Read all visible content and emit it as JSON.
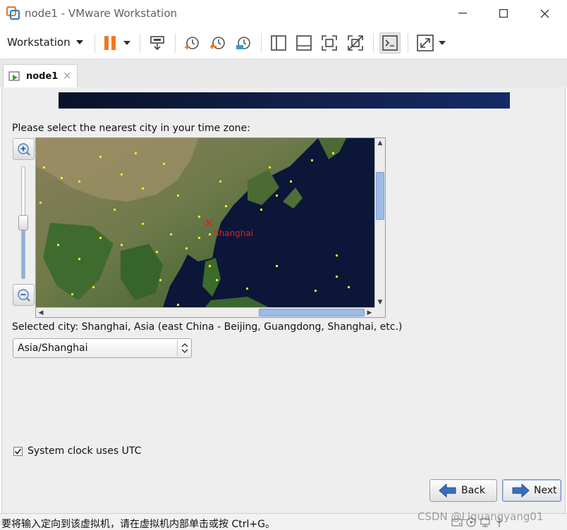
{
  "window": {
    "title": "node1 - VMware Workstation",
    "controls": [
      "minimize-icon",
      "maximize-icon",
      "close-icon"
    ]
  },
  "toolbar": {
    "workstation_menu": "Workstation",
    "icons": [
      "pause-icon",
      "send-ctrl-alt-del-icon",
      "snapshot-take-icon",
      "snapshot-revert-icon",
      "snapshot-manager-icon",
      "sidebar-toggle-icon",
      "thumbnail-bar-icon",
      "fullscreen-icon",
      "unity-icon",
      "console-view-icon",
      "stretch-guest-icon"
    ]
  },
  "tabs": [
    {
      "label": "node1",
      "icon": "vm-running-icon",
      "close": "×"
    }
  ],
  "installer": {
    "prompt": "Please select the nearest city in your time zone:",
    "map_city_label": "Shanghai",
    "selected_city_text": "Selected city: Shanghai, Asia (east China - Beijing, Guangdong, Shanghai, etc.)",
    "timezone_value": "Asia/Shanghai",
    "utc_checkbox_label": "System clock uses UTC",
    "utc_checked": true,
    "zoom_level": 0.53,
    "back_label": "Back",
    "next_label": "Next"
  },
  "statusbar": {
    "message": "要将输入定向到该虚拟机，请在虚拟机内部单击或按 Ctrl+G。",
    "watermark": "CSDN @Liguangyang01"
  },
  "colors": {
    "accent": "#f07a22",
    "selection": "#9dbbe4",
    "map_ocean": "#0b1638",
    "city_dot": "#f4ef2a",
    "city_selected": "#e0202a"
  }
}
